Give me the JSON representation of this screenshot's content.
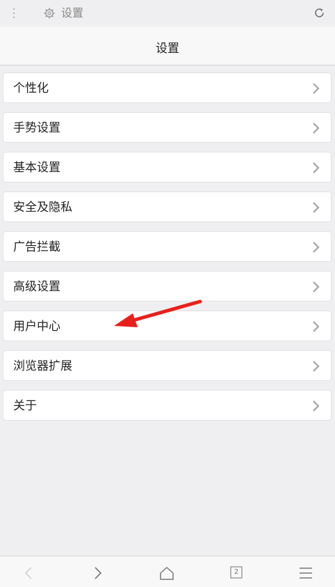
{
  "tabbar": {
    "title": "设置",
    "icons": [
      "more-vertical-icon",
      "gear-icon",
      "reload-icon"
    ]
  },
  "header": {
    "title": "设置"
  },
  "settings": {
    "items": [
      {
        "label": "个性化"
      },
      {
        "label": "手势设置"
      },
      {
        "label": "基本设置"
      },
      {
        "label": "安全及隐私"
      },
      {
        "label": "广告拦截"
      },
      {
        "label": "高级设置"
      },
      {
        "label": "用户中心"
      },
      {
        "label": "浏览器扩展"
      },
      {
        "label": "关于"
      }
    ]
  },
  "annotation": {
    "icon": "red-arrow-icon",
    "color": "#e8201c",
    "points_to": "用户中心"
  },
  "bottombar": {
    "tab_count": "2",
    "icons": [
      "back-icon",
      "forward-icon",
      "home-icon",
      "tabs-icon",
      "menu-icon"
    ]
  },
  "colors": {
    "background": "#efeff1",
    "card": "#ffffff",
    "chevron": "#aaaaaa",
    "arrow": "#e8201c"
  }
}
